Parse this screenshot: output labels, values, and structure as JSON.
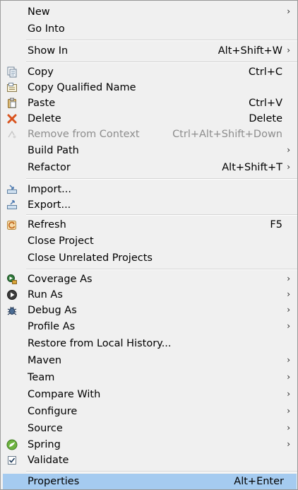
{
  "menu": {
    "new": {
      "label": "New"
    },
    "go_into": {
      "label": "Go Into"
    },
    "show_in": {
      "label": "Show In",
      "shortcut": "Alt+Shift+W"
    },
    "copy": {
      "label": "Copy",
      "shortcut": "Ctrl+C"
    },
    "copy_qualified_name": {
      "label": "Copy Qualified Name"
    },
    "paste": {
      "label": "Paste",
      "shortcut": "Ctrl+V"
    },
    "delete": {
      "label": "Delete",
      "shortcut": "Delete"
    },
    "remove_from_context": {
      "label": "Remove from Context",
      "shortcut": "Ctrl+Alt+Shift+Down",
      "disabled": true
    },
    "build_path": {
      "label": "Build Path"
    },
    "refactor": {
      "label": "Refactor",
      "shortcut": "Alt+Shift+T"
    },
    "import": {
      "label": "Import..."
    },
    "export": {
      "label": "Export..."
    },
    "refresh": {
      "label": "Refresh",
      "shortcut": "F5"
    },
    "close_project": {
      "label": "Close Project"
    },
    "close_unrelated_projects": {
      "label": "Close Unrelated Projects"
    },
    "coverage_as": {
      "label": "Coverage As"
    },
    "run_as": {
      "label": "Run As"
    },
    "debug_as": {
      "label": "Debug As"
    },
    "profile_as": {
      "label": "Profile As"
    },
    "restore_local_history": {
      "label": "Restore from Local History..."
    },
    "maven": {
      "label": "Maven"
    },
    "team": {
      "label": "Team"
    },
    "compare_with": {
      "label": "Compare With"
    },
    "configure": {
      "label": "Configure"
    },
    "source": {
      "label": "Source"
    },
    "spring": {
      "label": "Spring"
    },
    "validate": {
      "label": "Validate"
    },
    "properties": {
      "label": "Properties",
      "shortcut": "Alt+Enter",
      "selected": true
    }
  },
  "icons": {
    "copy": "copy-icon",
    "paste": "paste-icon",
    "delete": "delete-icon",
    "import": "import-icon",
    "export": "export-icon",
    "refresh": "refresh-icon",
    "coverage": "coverage-icon",
    "run": "run-icon",
    "debug": "debug-icon",
    "spring": "spring-icon",
    "validate": "checkbox-icon"
  },
  "colors": {
    "menu_background": "#f0f0f0",
    "selection": "#a5cbf0",
    "disabled_text": "#8d8d8d",
    "delete_icon": "#d9531e"
  }
}
